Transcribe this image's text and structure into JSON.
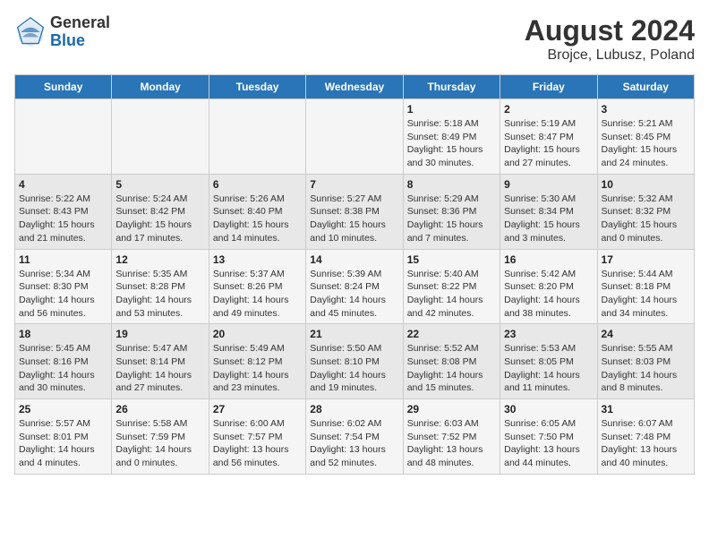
{
  "logo": {
    "general": "General",
    "blue": "Blue"
  },
  "title": "August 2024",
  "subtitle": "Brojce, Lubusz, Poland",
  "weekdays": [
    "Sunday",
    "Monday",
    "Tuesday",
    "Wednesday",
    "Thursday",
    "Friday",
    "Saturday"
  ],
  "weeks": [
    [
      {
        "day": "",
        "info": ""
      },
      {
        "day": "",
        "info": ""
      },
      {
        "day": "",
        "info": ""
      },
      {
        "day": "",
        "info": ""
      },
      {
        "day": "1",
        "info": "Sunrise: 5:18 AM\nSunset: 8:49 PM\nDaylight: 15 hours\nand 30 minutes."
      },
      {
        "day": "2",
        "info": "Sunrise: 5:19 AM\nSunset: 8:47 PM\nDaylight: 15 hours\nand 27 minutes."
      },
      {
        "day": "3",
        "info": "Sunrise: 5:21 AM\nSunset: 8:45 PM\nDaylight: 15 hours\nand 24 minutes."
      }
    ],
    [
      {
        "day": "4",
        "info": "Sunrise: 5:22 AM\nSunset: 8:43 PM\nDaylight: 15 hours\nand 21 minutes."
      },
      {
        "day": "5",
        "info": "Sunrise: 5:24 AM\nSunset: 8:42 PM\nDaylight: 15 hours\nand 17 minutes."
      },
      {
        "day": "6",
        "info": "Sunrise: 5:26 AM\nSunset: 8:40 PM\nDaylight: 15 hours\nand 14 minutes."
      },
      {
        "day": "7",
        "info": "Sunrise: 5:27 AM\nSunset: 8:38 PM\nDaylight: 15 hours\nand 10 minutes."
      },
      {
        "day": "8",
        "info": "Sunrise: 5:29 AM\nSunset: 8:36 PM\nDaylight: 15 hours\nand 7 minutes."
      },
      {
        "day": "9",
        "info": "Sunrise: 5:30 AM\nSunset: 8:34 PM\nDaylight: 15 hours\nand 3 minutes."
      },
      {
        "day": "10",
        "info": "Sunrise: 5:32 AM\nSunset: 8:32 PM\nDaylight: 15 hours\nand 0 minutes."
      }
    ],
    [
      {
        "day": "11",
        "info": "Sunrise: 5:34 AM\nSunset: 8:30 PM\nDaylight: 14 hours\nand 56 minutes."
      },
      {
        "day": "12",
        "info": "Sunrise: 5:35 AM\nSunset: 8:28 PM\nDaylight: 14 hours\nand 53 minutes."
      },
      {
        "day": "13",
        "info": "Sunrise: 5:37 AM\nSunset: 8:26 PM\nDaylight: 14 hours\nand 49 minutes."
      },
      {
        "day": "14",
        "info": "Sunrise: 5:39 AM\nSunset: 8:24 PM\nDaylight: 14 hours\nand 45 minutes."
      },
      {
        "day": "15",
        "info": "Sunrise: 5:40 AM\nSunset: 8:22 PM\nDaylight: 14 hours\nand 42 minutes."
      },
      {
        "day": "16",
        "info": "Sunrise: 5:42 AM\nSunset: 8:20 PM\nDaylight: 14 hours\nand 38 minutes."
      },
      {
        "day": "17",
        "info": "Sunrise: 5:44 AM\nSunset: 8:18 PM\nDaylight: 14 hours\nand 34 minutes."
      }
    ],
    [
      {
        "day": "18",
        "info": "Sunrise: 5:45 AM\nSunset: 8:16 PM\nDaylight: 14 hours\nand 30 minutes."
      },
      {
        "day": "19",
        "info": "Sunrise: 5:47 AM\nSunset: 8:14 PM\nDaylight: 14 hours\nand 27 minutes."
      },
      {
        "day": "20",
        "info": "Sunrise: 5:49 AM\nSunset: 8:12 PM\nDaylight: 14 hours\nand 23 minutes."
      },
      {
        "day": "21",
        "info": "Sunrise: 5:50 AM\nSunset: 8:10 PM\nDaylight: 14 hours\nand 19 minutes."
      },
      {
        "day": "22",
        "info": "Sunrise: 5:52 AM\nSunset: 8:08 PM\nDaylight: 14 hours\nand 15 minutes."
      },
      {
        "day": "23",
        "info": "Sunrise: 5:53 AM\nSunset: 8:05 PM\nDaylight: 14 hours\nand 11 minutes."
      },
      {
        "day": "24",
        "info": "Sunrise: 5:55 AM\nSunset: 8:03 PM\nDaylight: 14 hours\nand 8 minutes."
      }
    ],
    [
      {
        "day": "25",
        "info": "Sunrise: 5:57 AM\nSunset: 8:01 PM\nDaylight: 14 hours\nand 4 minutes."
      },
      {
        "day": "26",
        "info": "Sunrise: 5:58 AM\nSunset: 7:59 PM\nDaylight: 14 hours\nand 0 minutes."
      },
      {
        "day": "27",
        "info": "Sunrise: 6:00 AM\nSunset: 7:57 PM\nDaylight: 13 hours\nand 56 minutes."
      },
      {
        "day": "28",
        "info": "Sunrise: 6:02 AM\nSunset: 7:54 PM\nDaylight: 13 hours\nand 52 minutes."
      },
      {
        "day": "29",
        "info": "Sunrise: 6:03 AM\nSunset: 7:52 PM\nDaylight: 13 hours\nand 48 minutes."
      },
      {
        "day": "30",
        "info": "Sunrise: 6:05 AM\nSunset: 7:50 PM\nDaylight: 13 hours\nand 44 minutes."
      },
      {
        "day": "31",
        "info": "Sunrise: 6:07 AM\nSunset: 7:48 PM\nDaylight: 13 hours\nand 40 minutes."
      }
    ]
  ]
}
